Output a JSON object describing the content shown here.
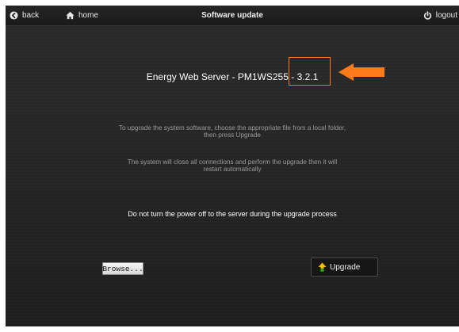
{
  "topbar": {
    "back_label": "back",
    "home_label": "home",
    "title": "Software update",
    "logout_label": "logout"
  },
  "main": {
    "heading": "Energy Web Server - PM1WS255 - 3.2.1",
    "instruction_line1": "To upgrade the system software, choose the appropriate file from a local folder,",
    "instruction_line2": "then press Upgrade",
    "notice_line1": "The system will close all connections and perform the upgrade then it will",
    "notice_line2": "restart automatically",
    "warning": "Do not turn the power off to the server during the upgrade process",
    "browse_label": "Browse...",
    "upgrade_label": "Upgrade"
  },
  "colors": {
    "annotation_orange": "#ff7a1a",
    "upgrade_icon_yellow": "#f2c200",
    "upgrade_icon_green": "#2db82d"
  },
  "icons": {
    "back": "back-circle-arrow-icon",
    "home": "home-icon",
    "logout": "power-icon",
    "upgrade": "upgrade-arrow-icon",
    "annotation": "orange-arrow-icon"
  }
}
